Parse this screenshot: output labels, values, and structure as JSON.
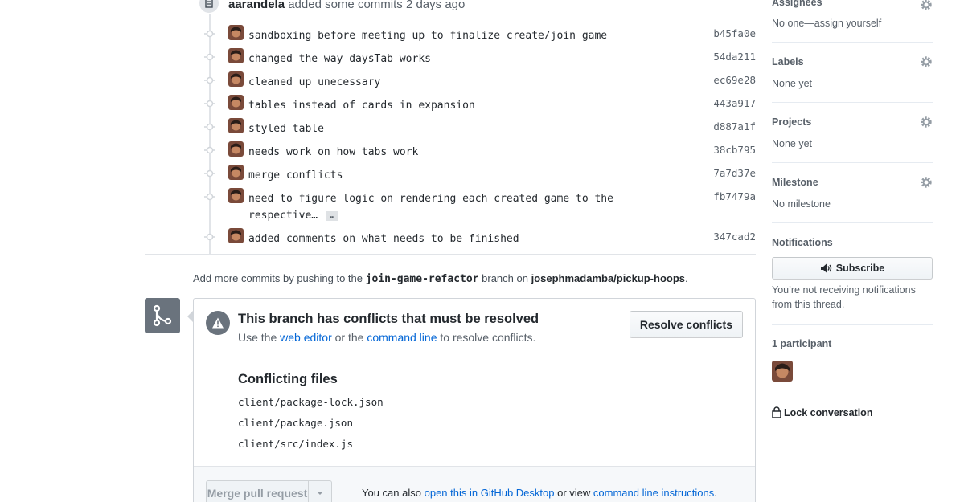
{
  "event": {
    "author": "aarandela",
    "action": "added some commits",
    "time": "2 days ago"
  },
  "commits": [
    {
      "message": "sandboxing before meeting up to finalize create/join game",
      "sha": "b45fa0e"
    },
    {
      "message": "changed the way daysTab works",
      "sha": "54da211"
    },
    {
      "message": "cleaned up unecessary",
      "sha": "ec69e28"
    },
    {
      "message": "tables instead of cards in expansion",
      "sha": "443a917"
    },
    {
      "message": "styled table",
      "sha": "d887a1f"
    },
    {
      "message": "needs work on how tabs work",
      "sha": "38cb795"
    },
    {
      "message": "merge conflicts",
      "sha": "7a7d37e"
    },
    {
      "message": "need to figure logic on rendering each created game to the",
      "message_cont": "respective…",
      "sha": "fb7479a"
    },
    {
      "message": "added comments on what needs to be finished",
      "sha": "347cad2"
    }
  ],
  "ellipsis_label": "…",
  "push_note": {
    "prefix": "Add more commits by pushing to the",
    "branch": "join-game-refactor",
    "middle": "branch on",
    "repo": "josephmadamba/pickup-hoops",
    "suffix": "."
  },
  "merge_box": {
    "conflict_title": "This branch has conflicts that must be resolved",
    "sub_prefix": "Use the",
    "web_editor_link": "web editor",
    "sub_middle": "or the",
    "command_line_link": "command line",
    "sub_suffix": "to resolve conflicts.",
    "resolve_button": "Resolve conflicts",
    "files_title": "Conflicting files",
    "files": [
      "client/package-lock.json",
      "client/package.json",
      "client/src/index.js"
    ],
    "merge_button": "Merge pull request",
    "footer_prefix": "You can also",
    "desktop_link": "open this in GitHub Desktop",
    "footer_middle": "or view",
    "instructions_link": "command line instructions",
    "footer_suffix": "."
  },
  "sidebar": {
    "assignees": {
      "heading": "Assignees",
      "value": "No one—assign yourself"
    },
    "labels": {
      "heading": "Labels",
      "value": "None yet"
    },
    "projects": {
      "heading": "Projects",
      "value": "None yet"
    },
    "milestone": {
      "heading": "Milestone",
      "value": "No milestone"
    },
    "notifications": {
      "heading": "Notifications",
      "subscribe_button": "Subscribe",
      "note": "You’re not receiving notifications from this thread."
    },
    "participants": {
      "heading": "1 participant"
    },
    "lock": {
      "label": "Lock conversation"
    }
  },
  "colors": {
    "link": "#0366d6",
    "text": "#24292e",
    "muted": "#586069",
    "border": "#e1e4e8"
  }
}
